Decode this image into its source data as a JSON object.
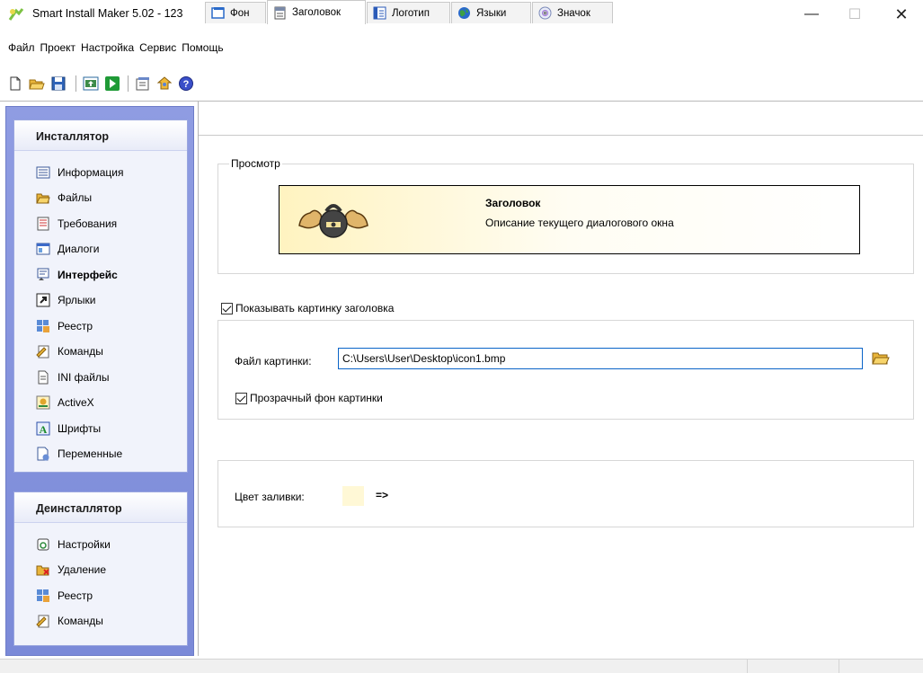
{
  "window": {
    "title": "Smart Install Maker 5.02 - 123",
    "minimize": "—",
    "maximize": "☐",
    "close": "✕"
  },
  "menu": [
    "Файл",
    "Проект",
    "Настройка",
    "Сервис",
    "Помощь"
  ],
  "toolbar": {
    "icons": [
      "new-file-icon",
      "open-folder-icon",
      "save-icon",
      "compile-icon",
      "run-icon",
      "settings-icon",
      "plugin-icon",
      "help-icon"
    ]
  },
  "sidebar": {
    "installer_title": "Инсталлятор",
    "installer_items": [
      {
        "label": "Информация",
        "icon": "info-list-icon"
      },
      {
        "label": "Файлы",
        "icon": "folder-files-icon"
      },
      {
        "label": "Требования",
        "icon": "requirements-icon"
      },
      {
        "label": "Диалоги",
        "icon": "dialogs-icon"
      },
      {
        "label": "Интерфейс",
        "icon": "interface-icon"
      },
      {
        "label": "Ярлыки",
        "icon": "shortcut-icon"
      },
      {
        "label": "Реестр",
        "icon": "registry-icon"
      },
      {
        "label": "Команды",
        "icon": "commands-icon"
      },
      {
        "label": "INI файлы",
        "icon": "ini-file-icon"
      },
      {
        "label": "ActiveX",
        "icon": "activex-icon"
      },
      {
        "label": "Шрифты",
        "icon": "fonts-icon"
      },
      {
        "label": "Переменные",
        "icon": "variables-icon"
      }
    ],
    "active_item": "Интерфейс",
    "uninstaller_title": "Деинсталлятор",
    "uninstaller_items": [
      {
        "label": "Настройки",
        "icon": "uninstall-settings-icon"
      },
      {
        "label": "Удаление",
        "icon": "delete-icon"
      },
      {
        "label": "Реестр",
        "icon": "registry-icon"
      },
      {
        "label": "Команды",
        "icon": "commands-icon"
      }
    ]
  },
  "tabs": [
    {
      "label": "Фон",
      "icon": "background-icon"
    },
    {
      "label": "Заголовок",
      "icon": "header-icon"
    },
    {
      "label": "Логотип",
      "icon": "logo-icon"
    },
    {
      "label": "Языки",
      "icon": "globe-icon"
    },
    {
      "label": "Значок",
      "icon": "cd-icon"
    }
  ],
  "active_tab": "Заголовок",
  "preview": {
    "legend": "Просмотр",
    "title": "Заголовок",
    "description": "Описание текущего диалогового окна"
  },
  "show_header_image": {
    "label": "Показывать картинку заголовка",
    "checked": true
  },
  "image_file": {
    "label": "Файл картинки:",
    "value": "C:\\Users\\User\\Desktop\\icon1.bmp"
  },
  "transparent_bg": {
    "label": "Прозрачный фон картинки",
    "checked": true
  },
  "fill_color": {
    "label": "Цвет заливки:",
    "arrow": "=>",
    "color": "#fff8d6"
  }
}
